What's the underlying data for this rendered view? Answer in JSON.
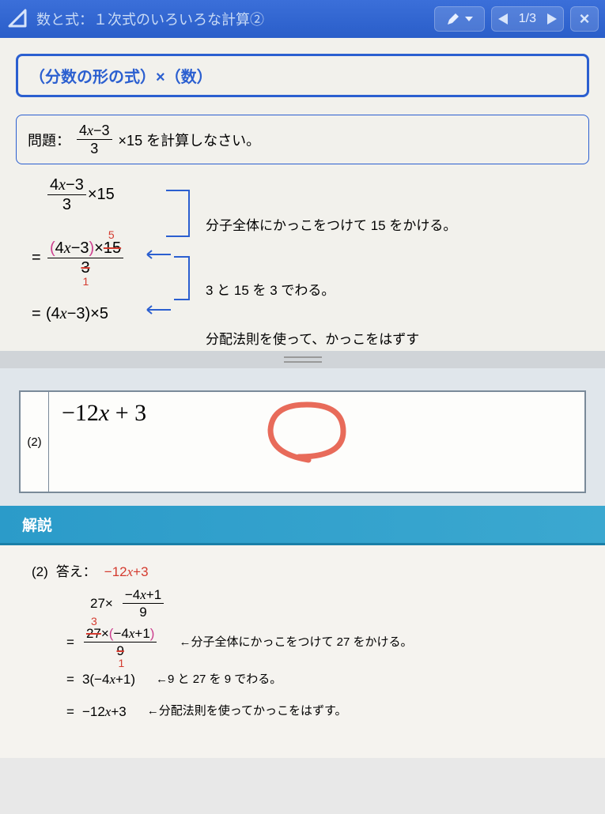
{
  "header": {
    "title": "数と式：１次式のいろいろな計算②",
    "counter": "1/3"
  },
  "section": {
    "title": "（分数の形の式）×（数）"
  },
  "problem": {
    "label": "問題：",
    "frac_num": "4x−3",
    "frac_den": "3",
    "tail": "×15 を計算しなさい。"
  },
  "steps": {
    "s1_num": "4x−3",
    "s1_den": "3",
    "s1_tail": "×15",
    "note1": "分子全体にかっこをつけて 15 をかける。",
    "s2_eq": "=",
    "s2_num_open": "(4x−3)",
    "s2_num_times": "×",
    "s2_num_15": "15",
    "s2_num_5": "5",
    "s2_den": "3",
    "s2_den_1": "1",
    "note2": "3 と 15 を 3 でわる。",
    "s3_eq": "=",
    "s3_body": "(4x−3)×5",
    "note3": "分配法則を使って、かっこをはずす"
  },
  "answer": {
    "num": "(2)",
    "expr": "−12x + 3"
  },
  "solution": {
    "header": "解説",
    "q_num": "(2)",
    "ans_label": "答え：",
    "ans_value": "−12x+3",
    "line1_a": "27×",
    "line1_num": "−4x+1",
    "line1_den": "9",
    "line2_eq": "=",
    "line2_27": "27",
    "line2_3": "3",
    "line2_times": "×",
    "line2_paren": "(−4x+1)",
    "line2_den": "9",
    "line2_1": "1",
    "note_a": "←分子全体にかっこをつけて 27 をかける。",
    "line3_eq": "=",
    "line3_body": "3(−4x+1)",
    "note_b": "←9 と 27 を 9 でわる。",
    "line4_eq": "=",
    "line4_body": "−12x+3",
    "note_c": "←分配法則を使ってかっこをはずす。"
  }
}
